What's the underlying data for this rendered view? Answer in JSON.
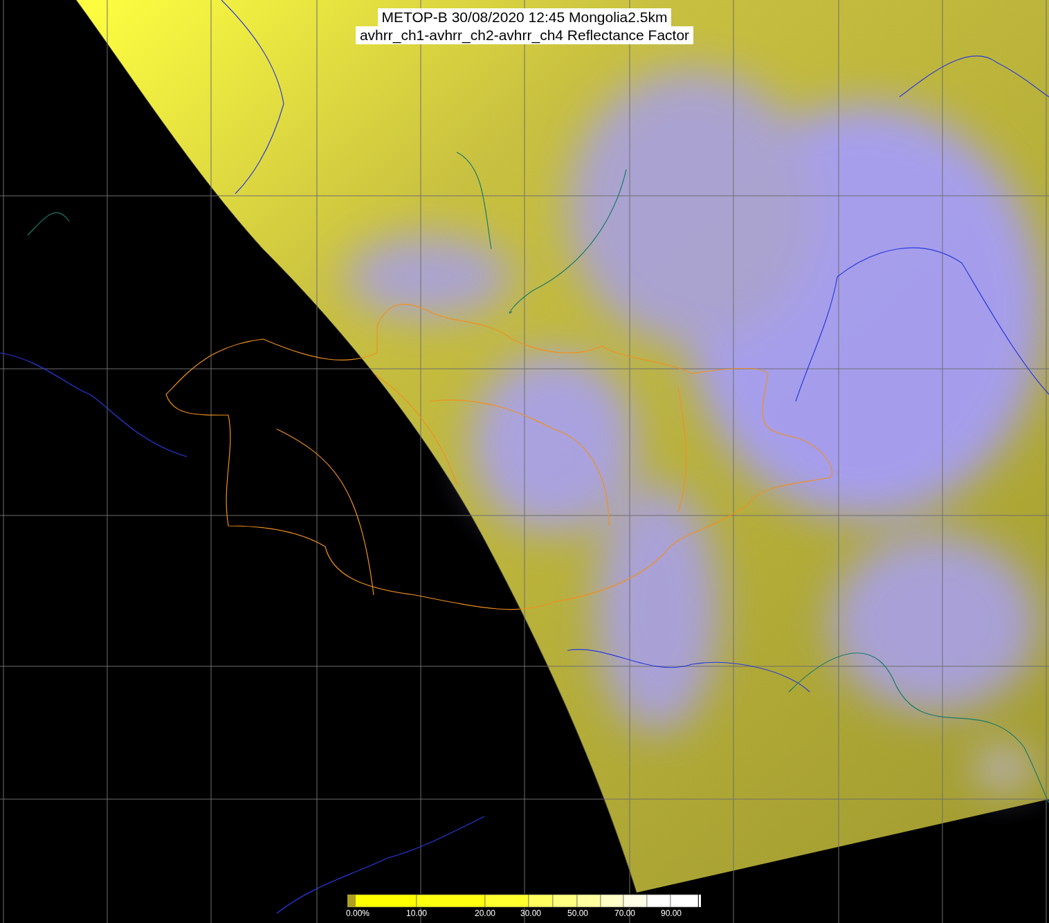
{
  "title": {
    "line_1": "METOP-B 30/08/2020 12:45 Mongolia2.5km",
    "line_2": "avhrr_ch1-avhrr_ch2-avhrr_ch4 Reflectance Factor"
  },
  "colorbar": {
    "labels": [
      "0.00%",
      "10.00",
      "20.00",
      "30.00",
      "50.00",
      "70.00",
      "90.00"
    ]
  }
}
